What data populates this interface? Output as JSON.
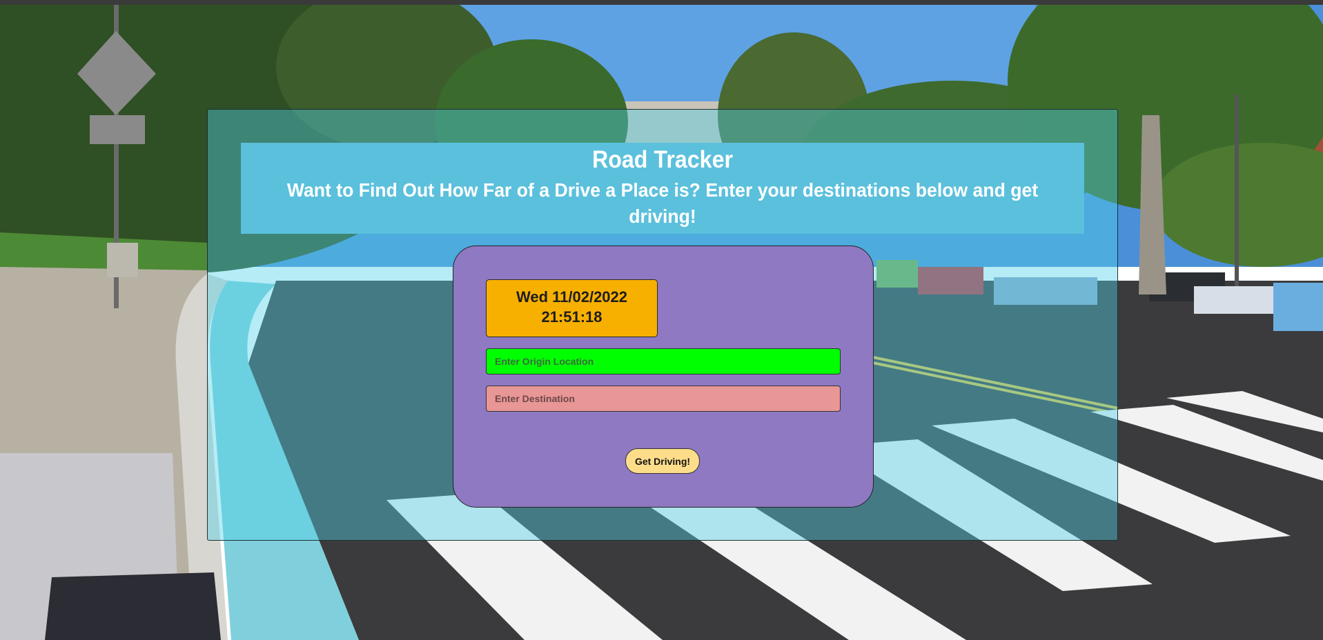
{
  "header": {
    "title": "Road Tracker",
    "subtitle": "Want to Find Out How Far of a Drive a Place is? Enter your destinations below and get driving!"
  },
  "clock": {
    "date": "Wed 11/02/2022",
    "time": "21:51:18"
  },
  "form": {
    "origin_placeholder": "Enter Origin Location",
    "destination_placeholder": "Enter Destination",
    "submit_label": "Get Driving!"
  },
  "colors": {
    "header_bg": "#5bc0dc",
    "card_bg": "#8e79c2",
    "clock_bg": "#f7b000",
    "origin_bg": "#00ff00",
    "destination_bg": "#e99696",
    "button_bg": "#fedd8a"
  },
  "background": {
    "icon": "street-crosswalk-photo"
  }
}
